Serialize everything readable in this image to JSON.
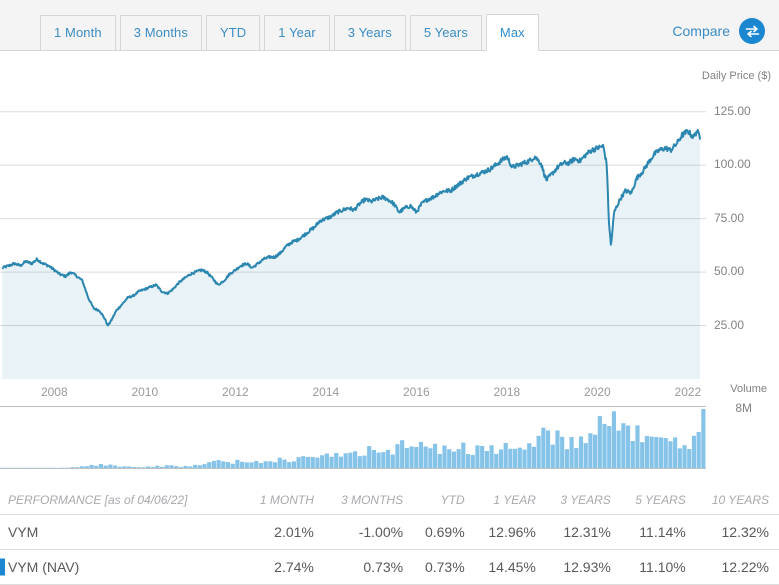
{
  "tabs": [
    {
      "label": "1 Month",
      "active": false
    },
    {
      "label": "3 Months",
      "active": false
    },
    {
      "label": "YTD",
      "active": false
    },
    {
      "label": "1 Year",
      "active": false
    },
    {
      "label": "3 Years",
      "active": false
    },
    {
      "label": "5 Years",
      "active": false
    },
    {
      "label": "Max",
      "active": true
    }
  ],
  "compare": {
    "label": "Compare",
    "icon": "swap-arrows-icon"
  },
  "colors": {
    "line": "#2b86b0",
    "area_fill": "#eaf4fa",
    "volume_bar": "#85c3e8",
    "accent": "#1b87d1",
    "tab_text": "#3a8dc4",
    "axis_text": "#808285",
    "gridline": "#dcdcdc"
  },
  "chart_data": {
    "type": "line",
    "title": "",
    "ylabel": "Daily Price ($)",
    "xlabel": "",
    "ylim": [
      0,
      137.5
    ],
    "yticks": [
      125.0,
      100.0,
      75.0,
      50.0,
      25.0
    ],
    "ytick_labels": [
      "125.00",
      "100.00",
      "75.00",
      "50.00",
      "25.00"
    ],
    "xlim": [
      2006.8,
      2022.4
    ],
    "xticks": [
      2008,
      2010,
      2012,
      2014,
      2016,
      2018,
      2020,
      2022
    ],
    "xtick_labels": [
      "2008",
      "2010",
      "2012",
      "2014",
      "2016",
      "2018",
      "2020",
      "2022"
    ],
    "grid": true,
    "legend_position": "none",
    "series": [
      {
        "name": "VYM",
        "color": "#2b86b0",
        "x": [
          2006.85,
          2007.0,
          2007.12,
          2007.25,
          2007.37,
          2007.5,
          2007.62,
          2007.75,
          2007.87,
          2008.0,
          2008.12,
          2008.25,
          2008.37,
          2008.5,
          2008.62,
          2008.75,
          2008.87,
          2009.0,
          2009.12,
          2009.18,
          2009.25,
          2009.37,
          2009.5,
          2009.62,
          2009.75,
          2009.87,
          2010.0,
          2010.12,
          2010.25,
          2010.37,
          2010.5,
          2010.62,
          2010.75,
          2010.87,
          2011.0,
          2011.12,
          2011.25,
          2011.37,
          2011.5,
          2011.62,
          2011.75,
          2011.87,
          2012.0,
          2012.12,
          2012.25,
          2012.37,
          2012.5,
          2012.62,
          2012.75,
          2012.87,
          2013.0,
          2013.12,
          2013.25,
          2013.37,
          2013.5,
          2013.62,
          2013.75,
          2013.87,
          2014.0,
          2014.12,
          2014.25,
          2014.37,
          2014.5,
          2014.62,
          2014.75,
          2014.87,
          2015.0,
          2015.12,
          2015.25,
          2015.37,
          2015.5,
          2015.62,
          2015.75,
          2015.87,
          2016.0,
          2016.12,
          2016.25,
          2016.37,
          2016.5,
          2016.62,
          2016.75,
          2016.87,
          2017.0,
          2017.12,
          2017.25,
          2017.37,
          2017.5,
          2017.62,
          2017.75,
          2017.87,
          2018.0,
          2018.12,
          2018.25,
          2018.37,
          2018.5,
          2018.62,
          2018.75,
          2018.87,
          2019.0,
          2019.12,
          2019.25,
          2019.37,
          2019.5,
          2019.62,
          2019.75,
          2019.87,
          2020.0,
          2020.13,
          2020.21,
          2020.25,
          2020.3,
          2020.37,
          2020.5,
          2020.62,
          2020.75,
          2020.87,
          2021.0,
          2021.12,
          2021.25,
          2021.37,
          2021.5,
          2021.62,
          2021.75,
          2021.87,
          2022.0,
          2022.12,
          2022.2,
          2022.27
        ],
        "y": [
          52,
          53,
          54,
          53,
          55,
          54,
          56,
          54,
          53,
          51,
          49,
          48,
          50,
          48,
          46,
          38,
          33,
          32,
          28,
          25,
          27,
          32,
          35,
          38,
          39,
          41,
          42,
          43,
          44,
          41,
          40,
          42,
          45,
          47,
          49,
          50,
          51,
          50,
          47,
          44,
          46,
          49,
          51,
          53,
          54,
          52,
          54,
          56,
          57,
          57,
          59,
          62,
          64,
          65,
          67,
          69,
          71,
          74,
          75,
          76,
          78,
          79,
          80,
          79,
          82,
          84,
          83,
          84,
          85,
          84,
          82,
          78,
          80,
          81,
          78,
          82,
          84,
          85,
          87,
          88,
          88,
          90,
          92,
          94,
          95,
          96,
          97,
          98,
          100,
          102,
          104,
          99,
          100,
          101,
          102,
          104,
          101,
          93,
          96,
          99,
          101,
          101,
          103,
          102,
          105,
          107,
          108,
          109,
          100,
          75,
          62,
          78,
          84,
          88,
          87,
          94,
          97,
          101,
          105,
          107,
          108,
          107,
          110,
          114,
          116,
          113,
          116,
          113
        ]
      }
    ],
    "volume": {
      "name": "Volume",
      "color": "#85c3e8",
      "axis_label": "8M",
      "ymax": 8,
      "unit": "M",
      "x": [
        2006.9,
        2007.1,
        2007.3,
        2007.5,
        2007.7,
        2007.9,
        2008.1,
        2008.3,
        2008.5,
        2008.7,
        2008.9,
        2009.1,
        2009.3,
        2009.5,
        2009.7,
        2009.9,
        2010.1,
        2010.3,
        2010.5,
        2010.7,
        2010.9,
        2011.1,
        2011.3,
        2011.5,
        2011.7,
        2011.9,
        2012.1,
        2012.3,
        2012.5,
        2012.7,
        2012.9,
        2013.1,
        2013.3,
        2013.5,
        2013.7,
        2013.9,
        2014.1,
        2014.3,
        2014.5,
        2014.7,
        2014.9,
        2015.1,
        2015.3,
        2015.5,
        2015.7,
        2015.9,
        2016.1,
        2016.3,
        2016.5,
        2016.7,
        2016.9,
        2017.1,
        2017.3,
        2017.5,
        2017.7,
        2017.9,
        2018.1,
        2018.3,
        2018.5,
        2018.7,
        2018.9,
        2019.1,
        2019.3,
        2019.5,
        2019.7,
        2019.9,
        2020.1,
        2020.3,
        2020.5,
        2020.7,
        2020.9,
        2021.1,
        2021.3,
        2021.5,
        2021.7,
        2021.9,
        2022.1,
        2022.3
      ],
      "y": [
        0.05,
        0.05,
        0.06,
        0.07,
        0.08,
        0.1,
        0.12,
        0.15,
        0.2,
        0.3,
        0.45,
        0.5,
        0.42,
        0.35,
        0.3,
        0.28,
        0.3,
        0.35,
        0.4,
        0.35,
        0.32,
        0.45,
        0.55,
        0.8,
        1.0,
        0.85,
        0.95,
        1.1,
        0.9,
        1.0,
        1.2,
        1.3,
        1.15,
        1.25,
        1.4,
        1.55,
        1.9,
        1.7,
        1.6,
        2.0,
        2.2,
        2.6,
        2.2,
        2.4,
        2.9,
        2.7,
        3.1,
        2.6,
        2.5,
        2.8,
        3.0,
        2.7,
        2.4,
        2.2,
        2.4,
        2.9,
        3.3,
        2.9,
        2.7,
        3.2,
        4.6,
        3.9,
        3.4,
        3.1,
        3.3,
        3.5,
        5.6,
        6.1,
        5.4,
        4.4,
        4.2,
        4.0,
        4.3,
        3.7,
        3.5,
        3.3,
        3.4,
        6.9
      ]
    }
  },
  "performance": {
    "title": "PERFORMANCE [as of 04/06/22]",
    "columns": [
      "1 MONTH",
      "3 MONTHS",
      "YTD",
      "1 YEAR",
      "3 YEARS",
      "5 YEARS",
      "10 YEARS"
    ],
    "rows": [
      {
        "name": "VYM",
        "marker": false,
        "values": [
          "2.01%",
          "-1.00%",
          "0.69%",
          "12.96%",
          "12.31%",
          "11.14%",
          "12.32%"
        ]
      },
      {
        "name": "VYM (NAV)",
        "marker": true,
        "values": [
          "2.74%",
          "0.73%",
          "0.73%",
          "14.45%",
          "12.93%",
          "11.10%",
          "12.22%"
        ]
      }
    ]
  }
}
